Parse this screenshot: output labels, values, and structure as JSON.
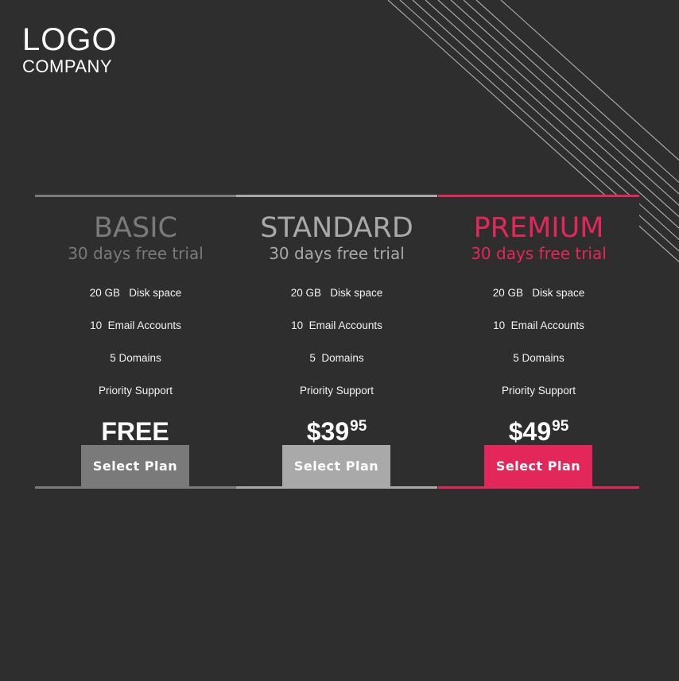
{
  "logo": {
    "main": "LOGO",
    "sub": "COMPANY"
  },
  "theme": {
    "background": "#2e2e2e",
    "accent": "#e4275a",
    "line_color": "#a8a8a8"
  },
  "plans": [
    {
      "name": "BASIC",
      "trial": "30 days free trial",
      "color": "#7a7a7a",
      "bar_color": "#7a7a7a",
      "button_color": "#7a7a7a",
      "features": [
        "20 GB   Disk space",
        "10  Email Accounts",
        "5 Domains",
        "Priority Support"
      ],
      "price_main": "FREE",
      "price_cents": "",
      "button_label": "Select Plan"
    },
    {
      "name": "STANDARD",
      "trial": "30 days free trial",
      "color": "#a9a9a9",
      "bar_color": "#a9a9a9",
      "button_color": "#a9a9a9",
      "features": [
        "20 GB   Disk space",
        "10  Email Accounts",
        "5  Domains",
        "Priority Support"
      ],
      "price_main": "$39",
      "price_cents": "95",
      "button_label": "Select Plan"
    },
    {
      "name": "PREMIUM",
      "trial": "30 days free trial",
      "color": "#e4275a",
      "bar_color": "#e4275a",
      "button_color": "#e4275a",
      "features": [
        "20 GB   Disk space",
        "10  Email Accounts",
        "5 Domains",
        "Priority Support"
      ],
      "price_main": "$49",
      "price_cents": "95",
      "button_label": "Select Plan"
    }
  ]
}
